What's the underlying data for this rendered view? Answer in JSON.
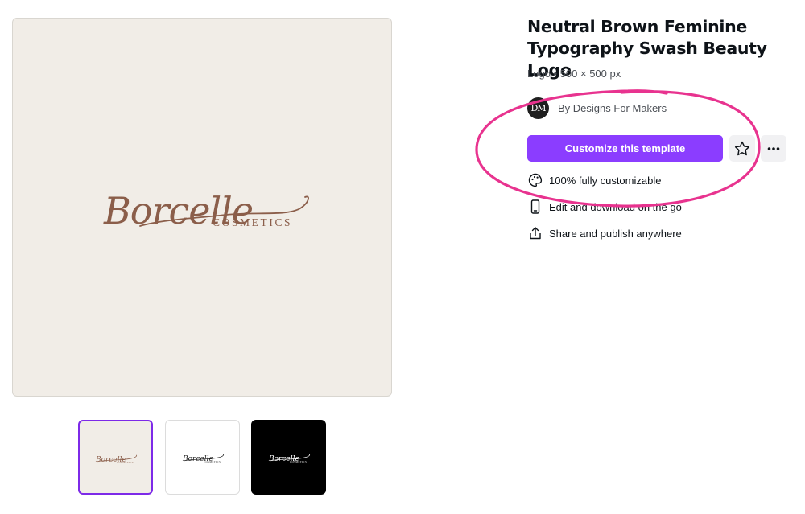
{
  "template": {
    "title": "Neutral Brown Feminine Typography Swash Beauty Logo",
    "meta": "Logo • 500 × 500 px",
    "avatar_initials": "DM",
    "by_label": "By",
    "author": "Designs For Makers"
  },
  "preview": {
    "brand_name": "Borcelle",
    "brand_tagline": "COSMETICS",
    "brand_color": "#8b5e4a",
    "background_color": "#f1ede7"
  },
  "actions": {
    "customize_label": "Customize this template",
    "customize_color": "#8b3dff",
    "favorite_icon": "star-icon",
    "more_icon": "more-horizontal-icon"
  },
  "features": [
    {
      "icon": "palette-icon",
      "label": "100% fully customizable"
    },
    {
      "icon": "mobile-phone-icon",
      "label": "Edit and download on the go"
    },
    {
      "icon": "share-upload-icon",
      "label": "Share and publish anywhere"
    }
  ],
  "thumbnails": [
    {
      "variant": "cream",
      "selected": true
    },
    {
      "variant": "white",
      "selected": false
    },
    {
      "variant": "black",
      "selected": false
    }
  ],
  "annotation": {
    "color": "#e8338f",
    "shape": "hand-drawn ellipse"
  }
}
